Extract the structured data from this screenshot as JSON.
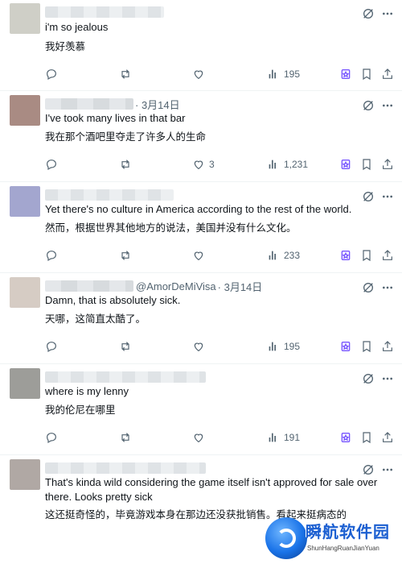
{
  "replies": [
    {
      "handle": "",
      "date": "",
      "text_en": "i'm so jealous",
      "text_zh": "我好羡慕",
      "reply_count": "",
      "repost_count": "",
      "like_count": "",
      "views": "195",
      "avatar_color": "#cfcfc7"
    },
    {
      "handle": "",
      "date": "· 3月14日",
      "text_en": "I've took many lives in that bar",
      "text_zh": "我在那个酒吧里夺走了许多人的生命",
      "reply_count": "",
      "repost_count": "",
      "like_count": "3",
      "views": "1,231",
      "avatar_color": "#a98b83"
    },
    {
      "handle": "",
      "date": "",
      "text_en": "Yet there's no culture in America according to the rest of the world.",
      "text_zh": "然而，根据世界其他地方的说法，美国并没有什么文化。",
      "reply_count": "",
      "repost_count": "",
      "like_count": "",
      "views": "233",
      "avatar_color": "#a3a6cf"
    },
    {
      "handle": "@AmorDeMiVisa",
      "date": "· 3月14日",
      "text_en": "Damn, that is absolutely sick.",
      "text_zh": "天哪，这简直太酷了。",
      "reply_count": "",
      "repost_count": "",
      "like_count": "",
      "views": "195",
      "avatar_color": "#d6ccc4"
    },
    {
      "handle": "",
      "date": "",
      "text_en": "where is my lenny",
      "text_zh": "我的伦尼在哪里",
      "reply_count": "",
      "repost_count": "",
      "like_count": "",
      "views": "191",
      "avatar_color": "#9d9d99"
    },
    {
      "handle": "",
      "date": "",
      "text_en": "That's kinda wild considering the game itself isn't approved for sale over there. Looks pretty sick",
      "text_zh": "这还挺奇怪的，毕竟游戏本身在那边还没获批销售。看起来挺病态的",
      "reply_count": "",
      "repost_count": "",
      "like_count": "",
      "views": "",
      "avatar_color": "#b0a8a4"
    }
  ],
  "icons": {
    "reply": "reply-icon",
    "repost": "repost-icon",
    "like": "heart-icon",
    "views": "views-chart-icon",
    "grok": "grok-icon",
    "bookmark": "bookmark-icon",
    "share": "share-icon",
    "more": "grok-slash-icon"
  },
  "watermark": {
    "title": "瞬航软件园",
    "subtitle": "ShunHangRuanJianYuan"
  },
  "colors": {
    "text": "#0f1419",
    "secondary": "#536471",
    "divider": "#eff3f4",
    "grok_accent": "#1d9bf0"
  }
}
